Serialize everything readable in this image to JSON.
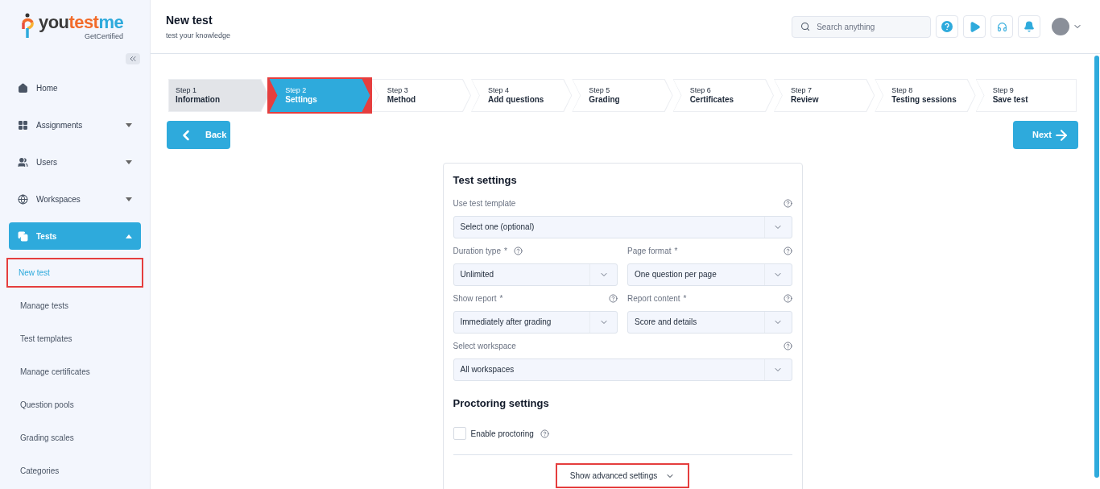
{
  "logo": {
    "parts": [
      {
        "text": "you",
        "color": "#3a3a3a"
      },
      {
        "text": "test",
        "color": "#f26b2a"
      },
      {
        "text": "me",
        "color": "#2eaadc"
      }
    ],
    "tagline": "GetCertified"
  },
  "sidebar": {
    "items": [
      {
        "label": "Home",
        "kind": "link",
        "selected": false
      },
      {
        "label": "Assignments",
        "kind": "group",
        "expanded": false,
        "selected": false
      },
      {
        "label": "Users",
        "kind": "group",
        "expanded": false,
        "selected": false
      },
      {
        "label": "Workspaces",
        "kind": "group",
        "expanded": false,
        "selected": false
      },
      {
        "label": "Tests",
        "kind": "group",
        "expanded": true,
        "selected": true,
        "children": [
          {
            "label": "New test",
            "selected": true,
            "highlighted": true
          },
          {
            "label": "Manage tests",
            "selected": false,
            "highlighted": false
          },
          {
            "label": "Test templates",
            "selected": false,
            "highlighted": false
          },
          {
            "label": "Manage certificates",
            "selected": false,
            "highlighted": false
          },
          {
            "label": "Question pools",
            "selected": false,
            "highlighted": false
          },
          {
            "label": "Grading scales",
            "selected": false,
            "highlighted": false
          },
          {
            "label": "Categories",
            "selected": false,
            "highlighted": false
          }
        ]
      }
    ]
  },
  "header": {
    "title": "New test",
    "subtitle": "test your knowledge",
    "search": {
      "placeholder": "Search anything"
    }
  },
  "steps": [
    {
      "number": "Step 1",
      "label": "Information",
      "completed": true,
      "selected": false,
      "highlighted": false
    },
    {
      "number": "Step 2",
      "label": "Settings",
      "completed": false,
      "selected": true,
      "highlighted": true
    },
    {
      "number": "Step 3",
      "label": "Method",
      "completed": false,
      "selected": false,
      "highlighted": false
    },
    {
      "number": "Step 4",
      "label": "Add questions",
      "completed": false,
      "selected": false,
      "highlighted": false
    },
    {
      "number": "Step 5",
      "label": "Grading",
      "completed": false,
      "selected": false,
      "highlighted": false
    },
    {
      "number": "Step 6",
      "label": "Certificates",
      "completed": false,
      "selected": false,
      "highlighted": false
    },
    {
      "number": "Step 7",
      "label": "Review",
      "completed": false,
      "selected": false,
      "highlighted": false
    },
    {
      "number": "Step 8",
      "label": "Testing sessions",
      "completed": false,
      "selected": false,
      "highlighted": false
    },
    {
      "number": "Step 9",
      "label": "Save test",
      "completed": false,
      "selected": false,
      "highlighted": false
    }
  ],
  "buttons": {
    "back": "Back",
    "next": "Next"
  },
  "test_settings": {
    "title": "Test settings",
    "rows": [
      [
        {
          "label": "Use test template",
          "value": "Select one (optional)",
          "kind": "standard"
        }
      ],
      [
        {
          "label": "Duration type",
          "required_mark": "*",
          "value": "Unlimited",
          "kind": "inline"
        },
        {
          "label": "Page format",
          "required_mark": "*",
          "value": "One question per page",
          "kind": "standard"
        }
      ],
      [
        {
          "label": "Show report",
          "required_mark": "*",
          "value": "Immediately after grading",
          "kind": "standard"
        },
        {
          "label": "Report content",
          "required_mark": "*",
          "value": "Score and details",
          "kind": "standard"
        }
      ],
      [
        {
          "label": "Select workspace",
          "value": "All workspaces",
          "kind": "standard"
        }
      ]
    ]
  },
  "proctoring_settings": {
    "title": "Proctoring settings",
    "enable_proctoring": {
      "label": "Enable proctoring",
      "checked": false
    }
  },
  "advanced": {
    "label": "Show advanced settings",
    "highlighted": true
  }
}
